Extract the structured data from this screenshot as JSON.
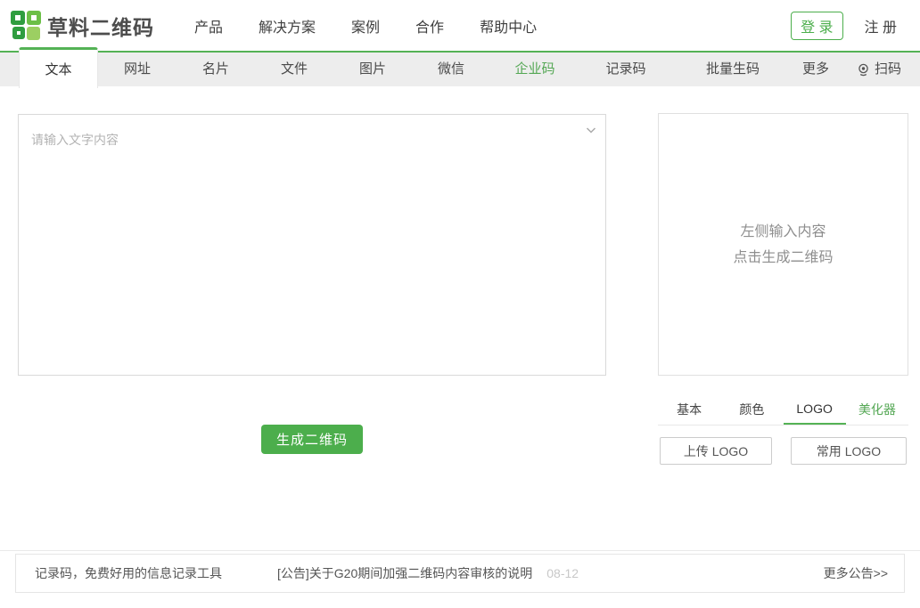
{
  "header": {
    "logo_text": "草料二维码",
    "nav": [
      "产品",
      "解决方案",
      "案例",
      "合作",
      "帮助中心"
    ],
    "login_label": "登 录",
    "register_label": "注 册"
  },
  "tabbar": {
    "tabs": [
      "文本",
      "网址",
      "名片",
      "文件",
      "图片",
      "微信",
      "企业码",
      "记录码",
      "批量生码",
      "更多",
      "扫码"
    ],
    "active_tab": "文本",
    "scan_icon": "webcam-icon"
  },
  "editor": {
    "placeholder": "请输入文字内容",
    "generate_button": "生成二维码"
  },
  "preview": {
    "line1": "左侧输入内容",
    "line2": "点击生成二维码"
  },
  "style_panel": {
    "tabs": [
      "基本",
      "颜色",
      "LOGO",
      "美化器"
    ],
    "active_tab": "LOGO",
    "upload_logo_button": "上传 LOGO",
    "common_logo_button": "常用 LOGO"
  },
  "footer": {
    "left_text": "记录码，免费好用的信息记录工具",
    "notice": "[公告]关于G20期间加强二维码内容审核的说明",
    "notice_date": "08-12",
    "more_link": "更多公告>>"
  },
  "colors": {
    "brand_green": "#4cae4c",
    "tab_green": "#54b255",
    "logo_dark_green": "#2f9d3f",
    "logo_mid_green": "#6cbf47",
    "logo_light_green": "#9ccf62",
    "link_green": "#54a754"
  }
}
